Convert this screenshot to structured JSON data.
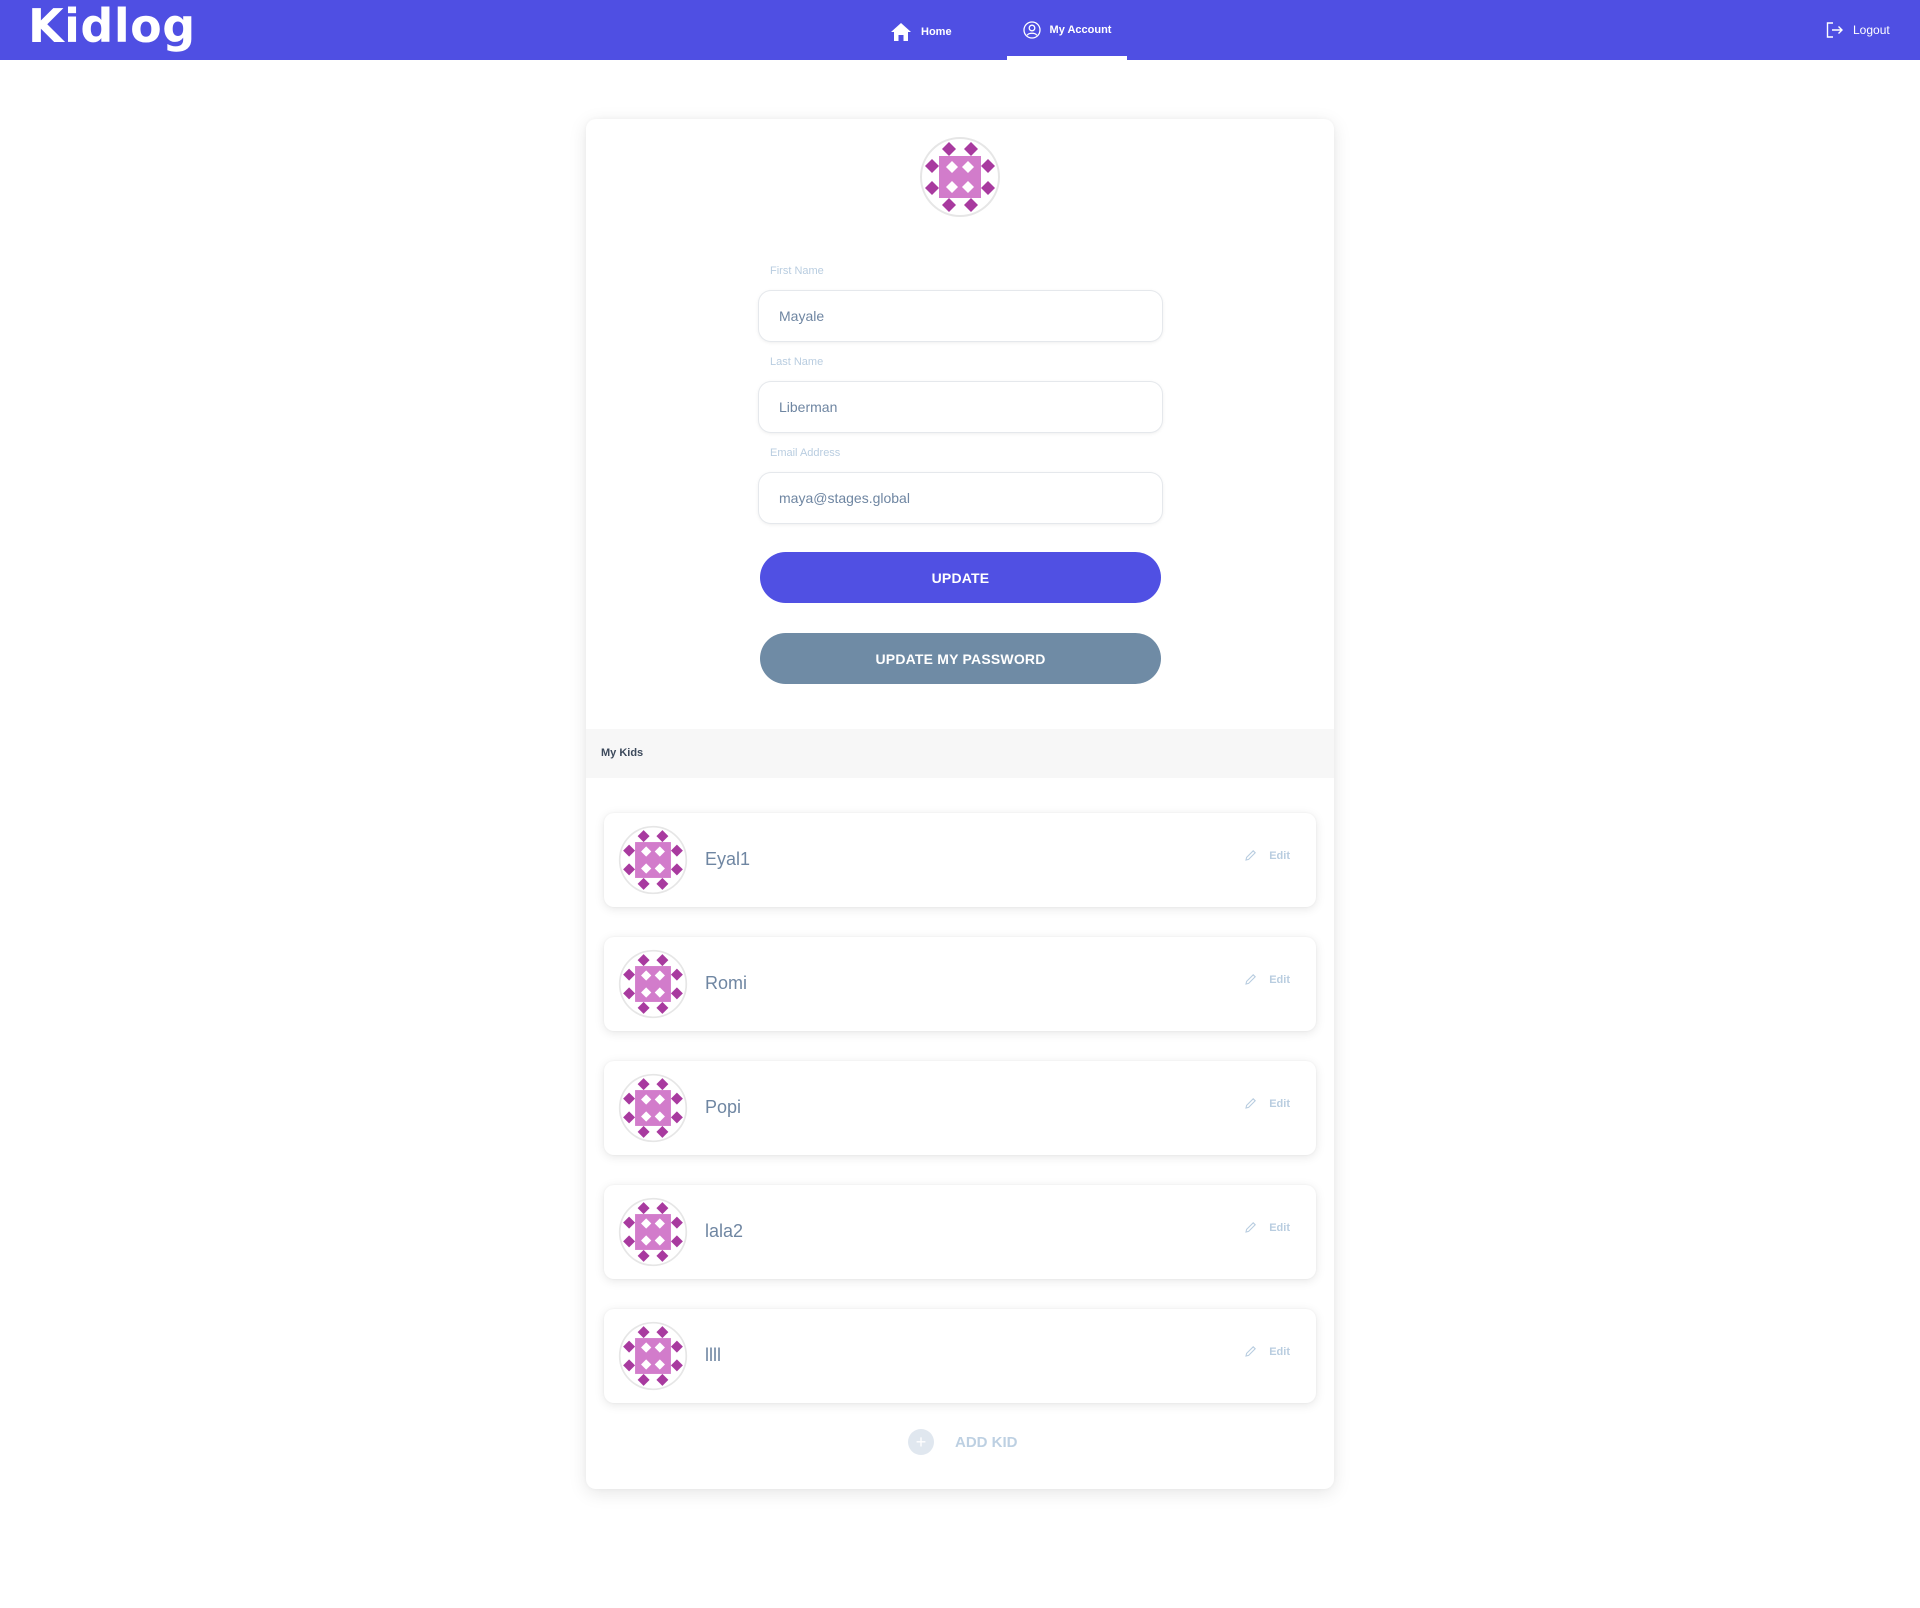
{
  "brand": {
    "name": "Kidlog",
    "header_color": "#4f4fe3"
  },
  "nav": {
    "items": [
      {
        "label": "Home",
        "icon": "home-icon",
        "active": false
      },
      {
        "label": "My Account",
        "icon": "user-circle-icon",
        "active": true
      }
    ],
    "logout": {
      "label": "Logout",
      "icon": "logout-icon"
    }
  },
  "profile": {
    "avatar": "identicon-avatar",
    "fields": [
      {
        "label": "First Name",
        "value": "Mayale"
      },
      {
        "label": "Last Name",
        "value": "Liberman"
      },
      {
        "label": "Email Address",
        "value": "maya@stages.global"
      }
    ],
    "update_label": "UPDATE",
    "update_password_label": "UPDATE MY PASSWORD"
  },
  "kids": {
    "title": "My Kids",
    "edit_label": "Edit",
    "items": [
      {
        "name": "Eyal1"
      },
      {
        "name": "Romi"
      },
      {
        "name": "Popi"
      },
      {
        "name": "lala2"
      },
      {
        "name": "llll"
      }
    ],
    "add_label": "ADD KID"
  },
  "colors": {
    "primary": "#5050e3",
    "secondary_button": "#6f8ba5",
    "label": "#b9cde0",
    "input_text": "#6f86a2",
    "avatar_dark": "#a83a9f",
    "avatar_light": "#d27ccb"
  }
}
